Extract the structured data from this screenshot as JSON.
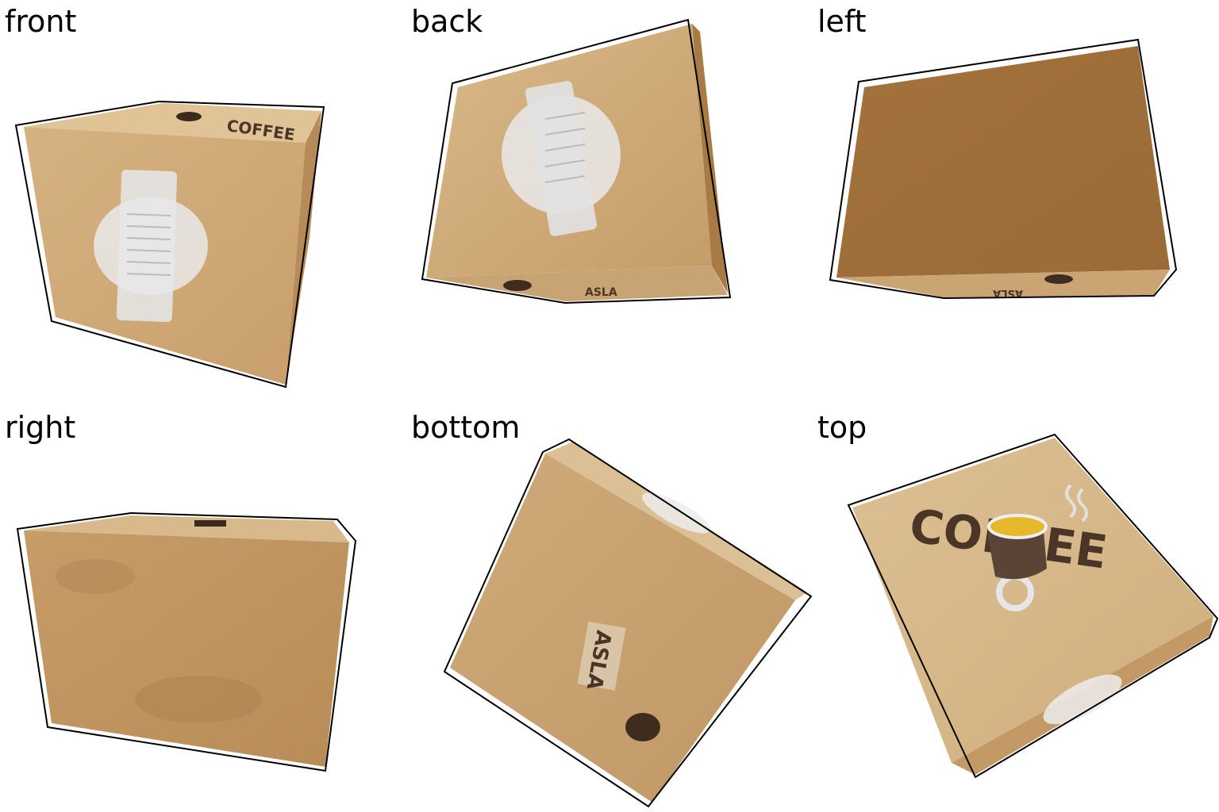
{
  "views": [
    {
      "label": "front"
    },
    {
      "label": "back"
    },
    {
      "label": "left"
    },
    {
      "label": "right"
    },
    {
      "label": "bottom"
    },
    {
      "label": "top"
    }
  ],
  "box_print": {
    "brand": "COFFEE",
    "stamp": "ASLA"
  },
  "colors": {
    "cardboard_light": "#d8b688",
    "cardboard_mid": "#c59d6c",
    "cardboard_dark": "#a8773f",
    "label_white": "#e9e9ea",
    "ink_brown": "#4a3526",
    "outline": "#000000"
  }
}
